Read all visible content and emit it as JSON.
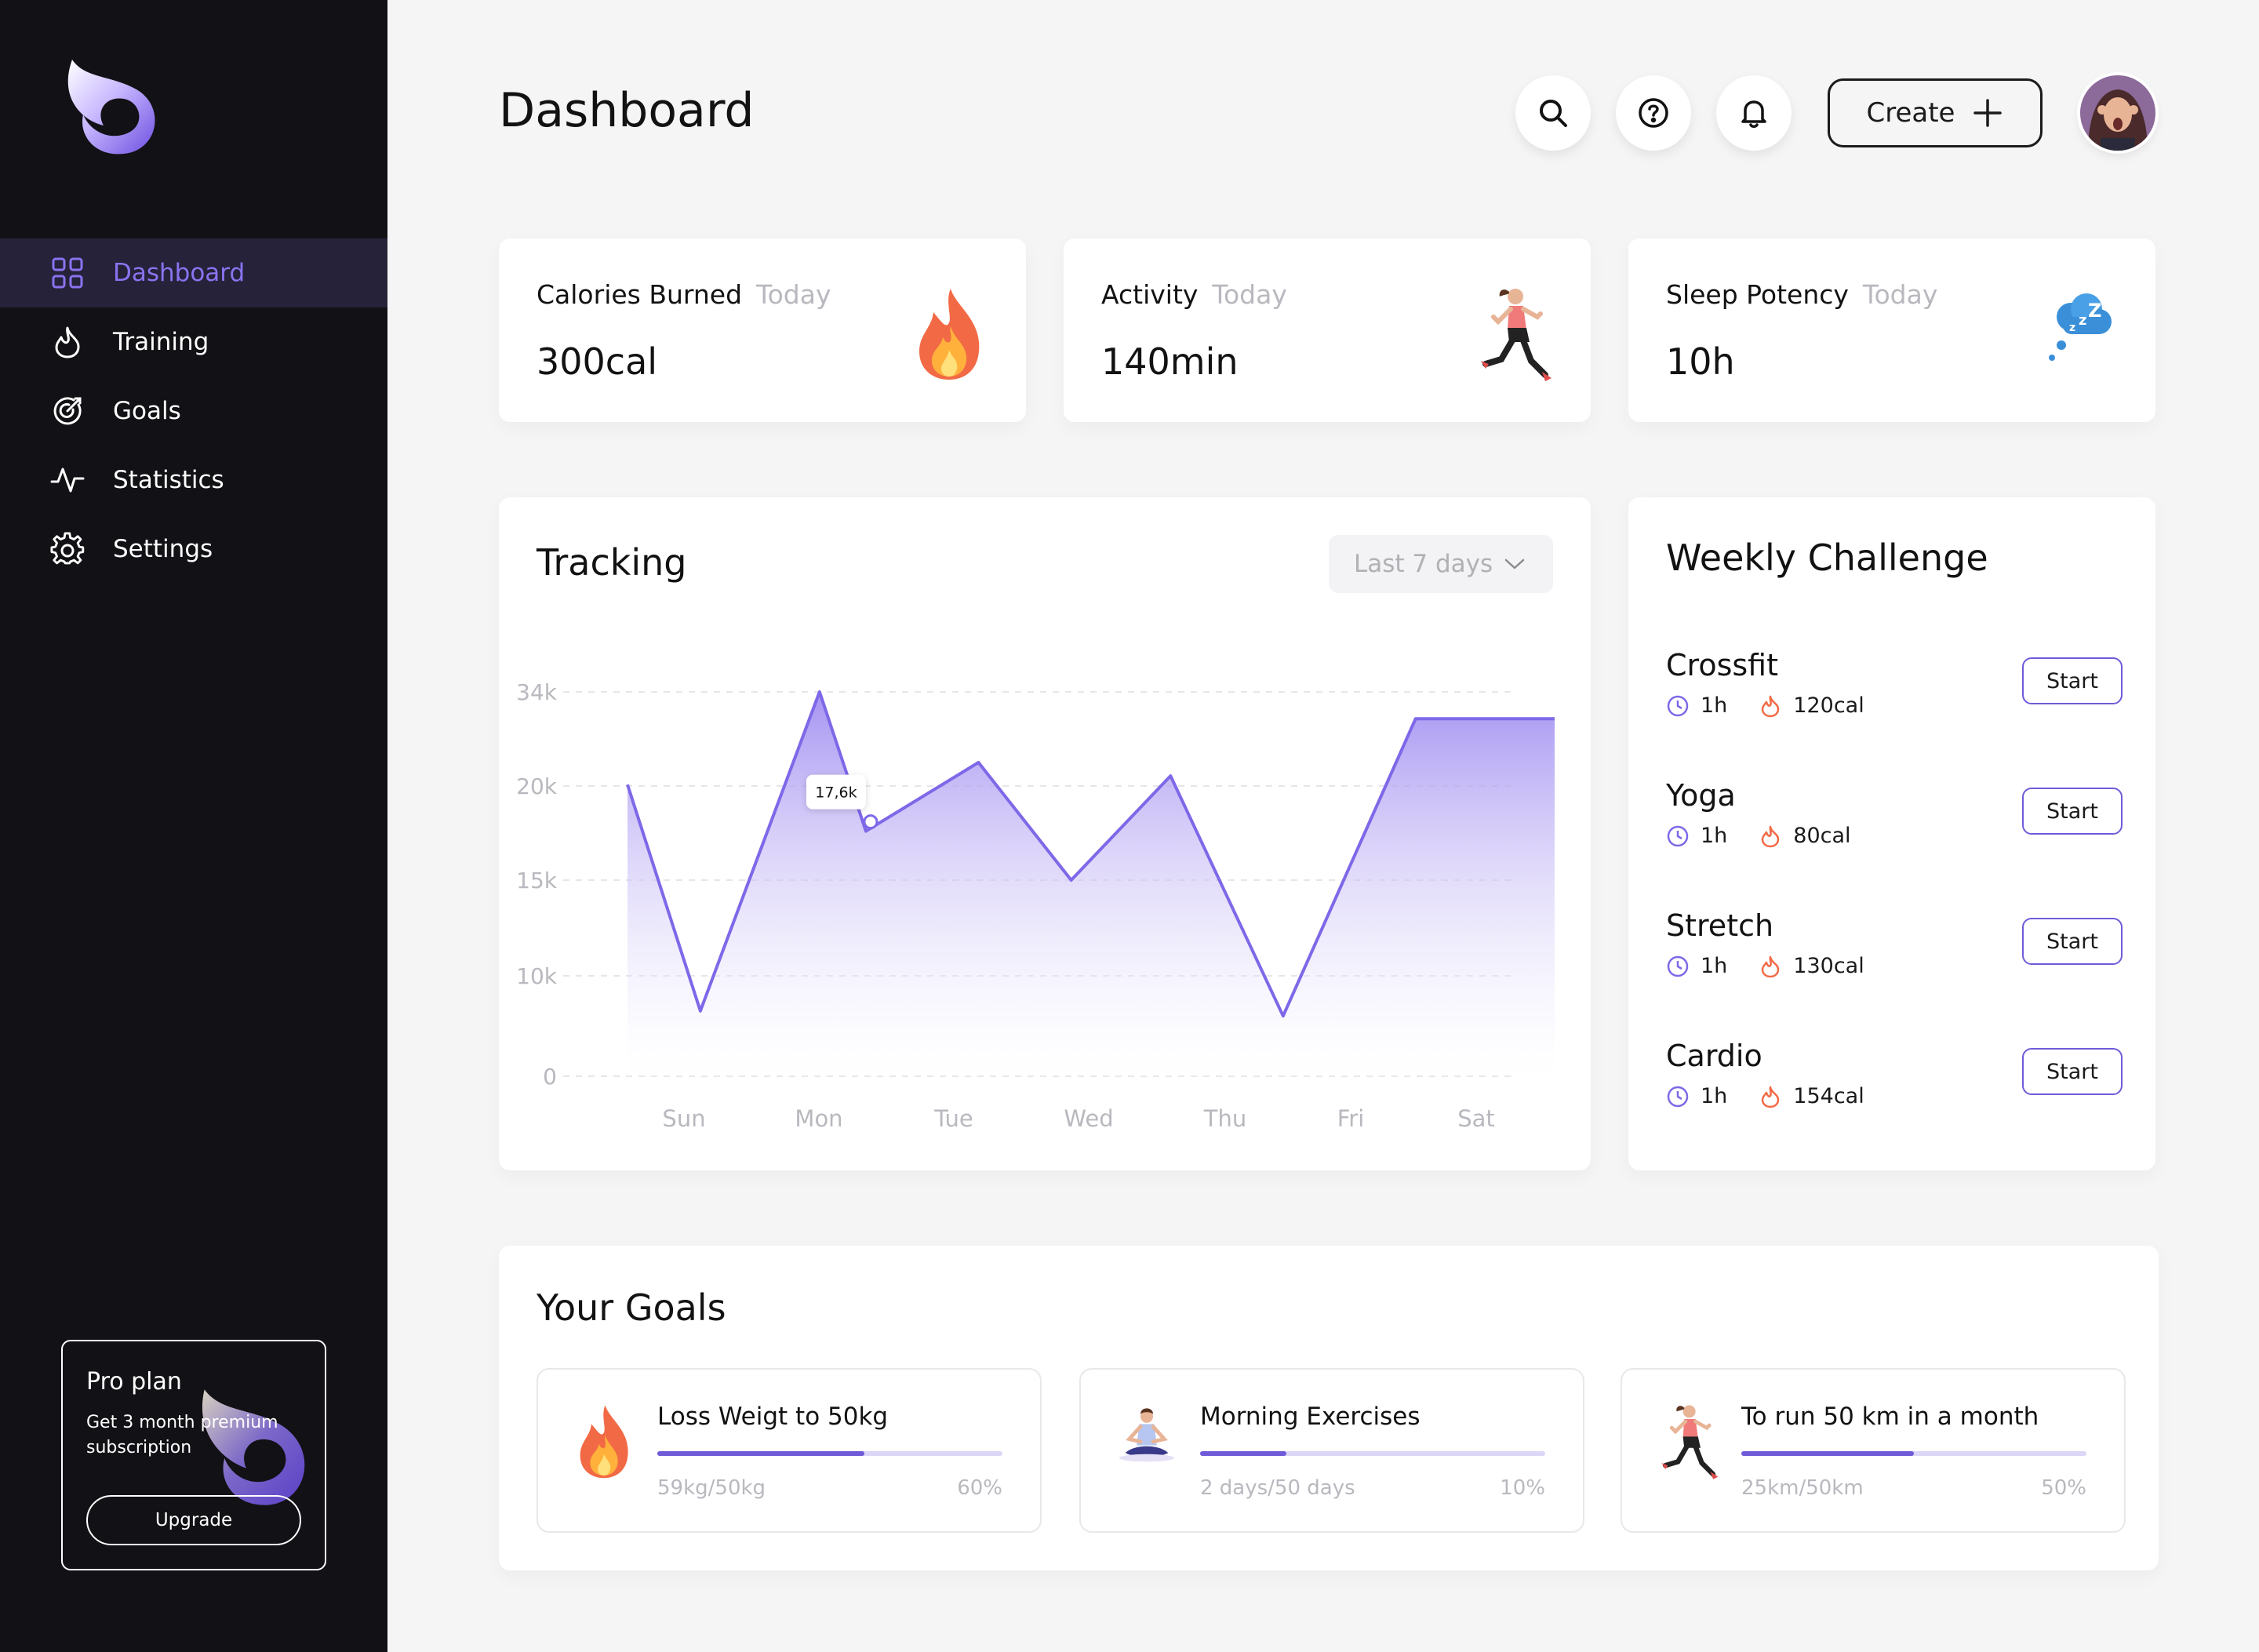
{
  "app": {
    "title": "Dashboard"
  },
  "sidebar": {
    "items": [
      {
        "label": "Dashboard",
        "icon": "grid-icon",
        "active": true
      },
      {
        "label": "Training",
        "icon": "flame-icon"
      },
      {
        "label": "Goals",
        "icon": "target-icon"
      },
      {
        "label": "Statistics",
        "icon": "pulse-icon"
      },
      {
        "label": "Settings",
        "icon": "gear-icon"
      }
    ],
    "pro": {
      "title": "Pro plan",
      "subtitle": "Get 3 month premium subscription",
      "button": "Upgrade"
    }
  },
  "header": {
    "title": "Dashboard",
    "icons": [
      "search-icon",
      "help-icon",
      "bell-icon"
    ],
    "create_label": "Create"
  },
  "stats": [
    {
      "label": "Calories Burned",
      "sub": "Today",
      "value": "300cal",
      "icon": "fire-illustration"
    },
    {
      "label": "Activity",
      "sub": "Today",
      "value": "140min",
      "icon": "runner-illustration"
    },
    {
      "label": "Sleep Potency",
      "sub": "Today",
      "value": "10h",
      "icon": "sleep-cloud-illustration"
    }
  ],
  "tracking": {
    "title": "Tracking",
    "range": "Last 7 days"
  },
  "chart_data": {
    "type": "area",
    "title": "Tracking",
    "categories": [
      "Sun",
      "Mon",
      "Tue",
      "Wed",
      "Thu",
      "Fri",
      "Sat"
    ],
    "y_ticks": [
      "34k",
      "20k",
      "15k",
      "10k",
      "0"
    ],
    "x": [
      0,
      0.55,
      1.45,
      1.8,
      2.65,
      3.35,
      4.1,
      4.95,
      5.95,
      7
    ],
    "y": [
      20.2,
      6.5,
      34,
      17.6,
      23.5,
      15,
      21.5,
      6,
      30,
      30
    ],
    "ylim": [
      0,
      34
    ],
    "tooltip": {
      "label": "17,6k",
      "x": 1.8,
      "y": 17.6
    },
    "color": "#7f68e8",
    "grid": true
  },
  "weekly": {
    "title": "Weekly Challenge",
    "items": [
      {
        "name": "Crossfit",
        "time": "1h",
        "cal": "120cal",
        "button": "Start"
      },
      {
        "name": "Yoga",
        "time": "1h",
        "cal": "80cal",
        "button": "Start"
      },
      {
        "name": "Stretch",
        "time": "1h",
        "cal": "130cal",
        "button": "Start"
      },
      {
        "name": "Cardio",
        "time": "1h",
        "cal": "154cal",
        "button": "Start"
      }
    ]
  },
  "goals": {
    "title": "Your Goals",
    "items": [
      {
        "title": "Loss Weigt to 50kg",
        "left": "59kg/50kg",
        "right": "60%",
        "progress": 0.6,
        "icon": "fire-illustration"
      },
      {
        "title": "Morning Exercises",
        "left": "2 days/50 days",
        "right": "10%",
        "progress": 0.25,
        "icon": "yoga-illustration"
      },
      {
        "title": "To run 50 km in a month",
        "left": "25km/50km",
        "right": "50%",
        "progress": 0.5,
        "icon": "runner-illustration"
      }
    ]
  }
}
